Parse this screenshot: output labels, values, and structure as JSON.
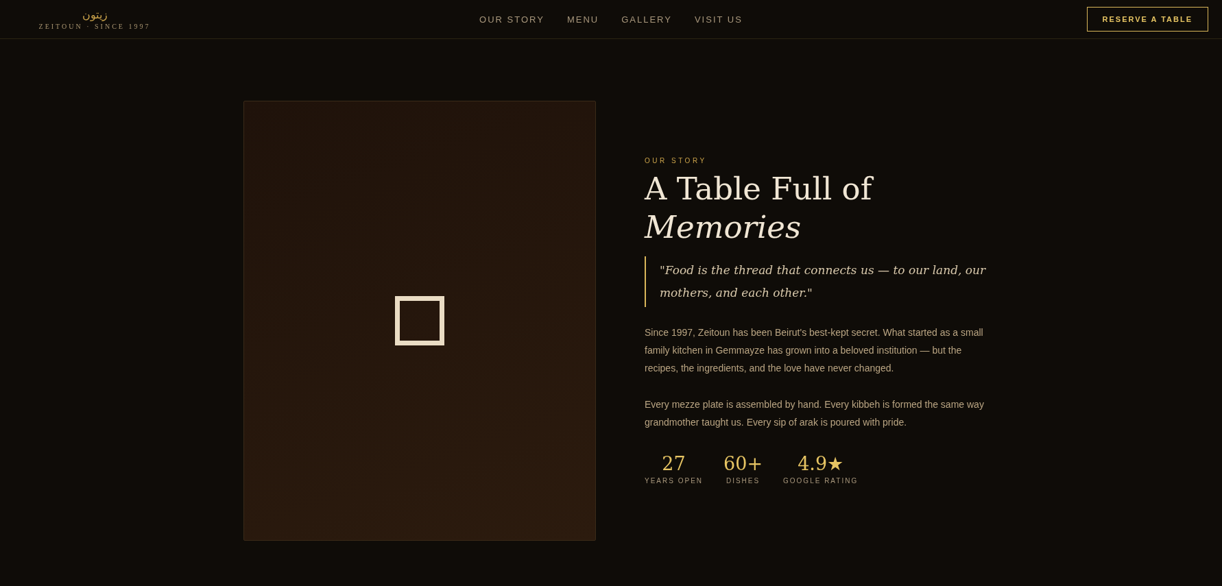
{
  "header": {
    "logo_arabic": "زيتون",
    "logo_text": "ZEITOUN · SINCE 1997",
    "nav": [
      {
        "label": "OUR STORY"
      },
      {
        "label": "MENU"
      },
      {
        "label": "GALLERY"
      },
      {
        "label": "VISIT US"
      }
    ],
    "cta": "RESERVE A TABLE"
  },
  "story": {
    "eyebrow": "OUR STORY",
    "title": "A Table Full of *Memories*",
    "quote": "\"Food is the thread that connects us — to our land, our mothers, and each other.\"",
    "paragraphs": [
      "Since 1997, Zeitoun has been Beirut's best-kept secret. What started as a small family kitchen in Gemmayze has grown into a beloved institution — but the recipes, the ingredients, and the love have never changed.",
      "Every mezze plate is assembled by hand. Every kibbeh is formed the same way grandmother taught us. Every sip of arak is poured with pride."
    ],
    "stats": [
      {
        "value": "27",
        "label": "YEARS OPEN"
      },
      {
        "value": "60+",
        "label": "DISHES"
      },
      {
        "value": "4.9★",
        "label": "GOOGLE RATING"
      }
    ]
  }
}
